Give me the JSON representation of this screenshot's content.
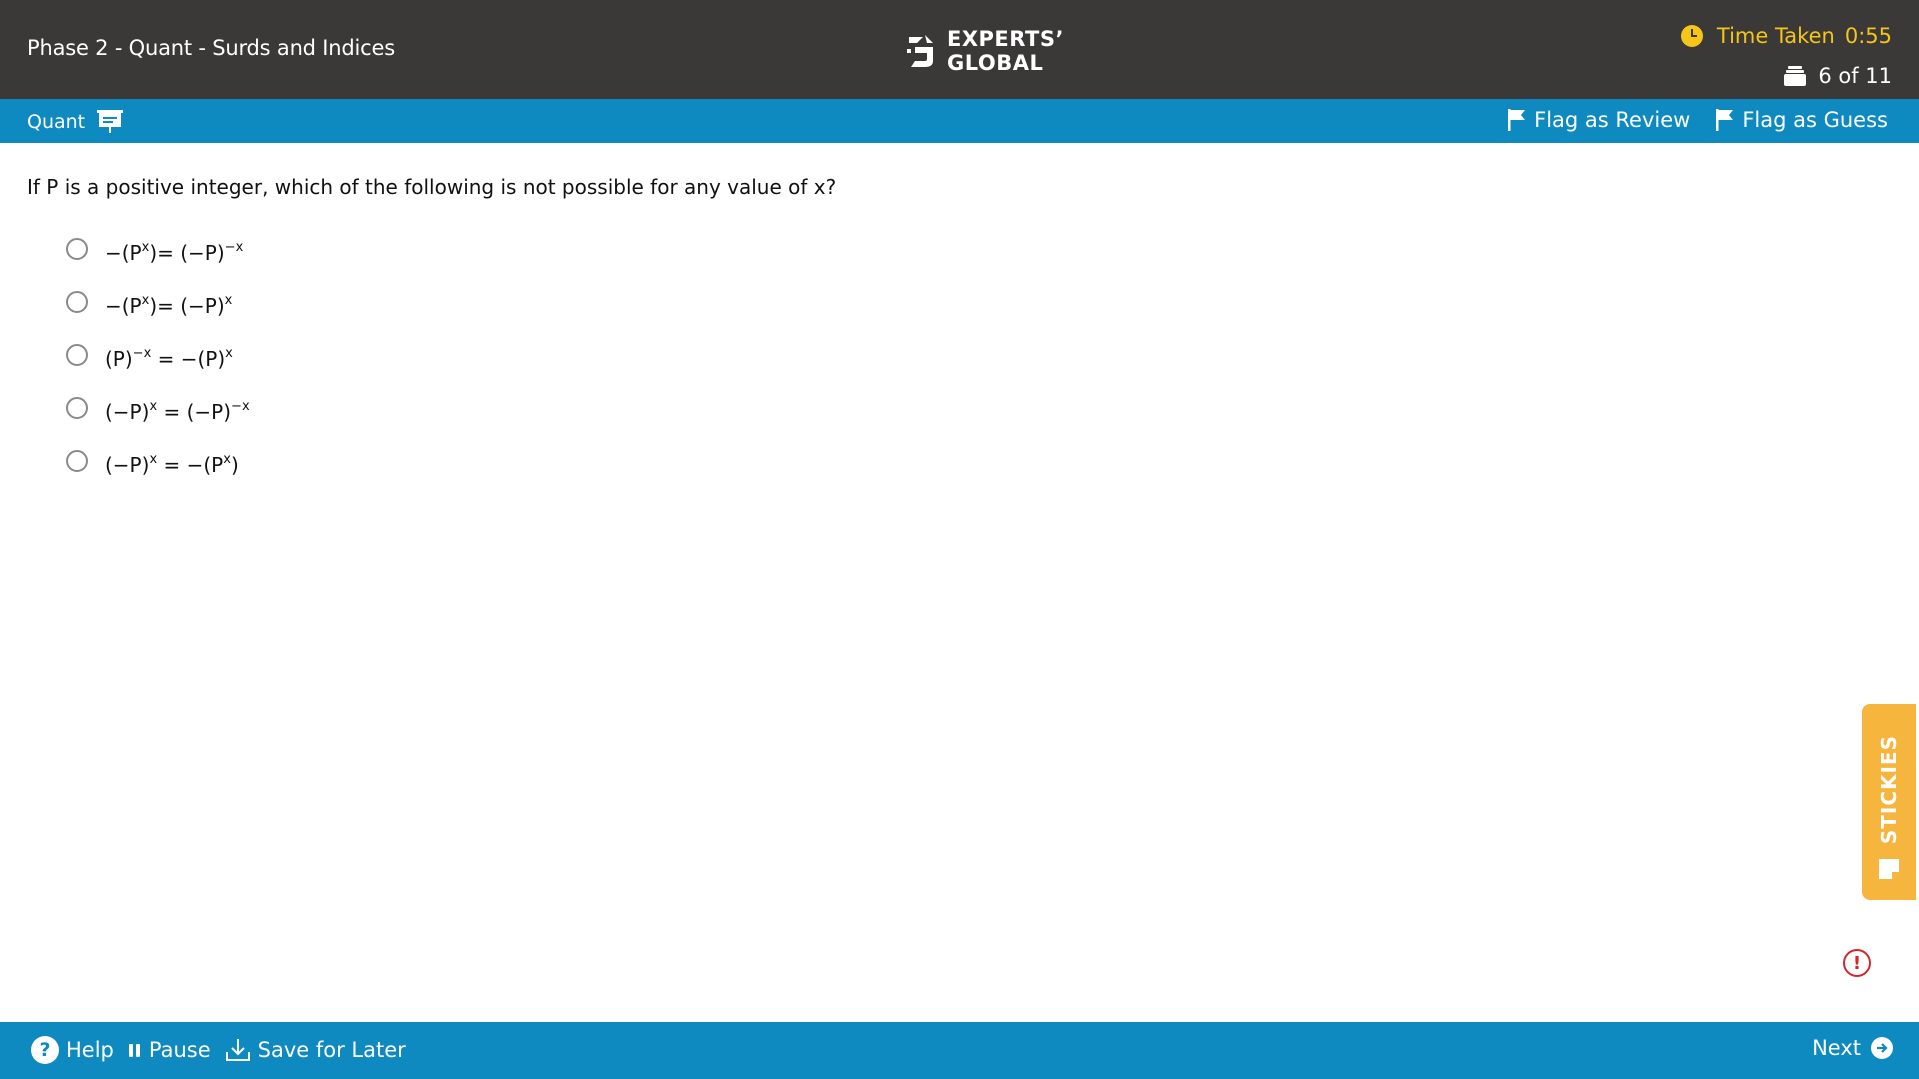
{
  "header": {
    "exam_title": "Phase 2 - Quant - Surds and Indices",
    "logo": {
      "line1": "EXPERTS’",
      "line2": "GLOBAL"
    },
    "timer_label": "Time Taken",
    "timer_value": "0:55",
    "question_counter": "6 of 11"
  },
  "section_bar": {
    "section_name": "Quant",
    "flag_review_label": "Flag as Review",
    "flag_guess_label": "Flag as Guess"
  },
  "question": {
    "text": "If P is a positive integer, which of the following is not possible for any value of x?",
    "options": [
      {
        "label": "−(P^x)= (−P)^−x"
      },
      {
        "label": "−(P^x)= (−P)^x"
      },
      {
        "label": "(P)^−x = −(P)^x"
      },
      {
        "label": "(−P)^x = (−P)^−x"
      },
      {
        "label": "(−P)^x = −(P^x)"
      }
    ],
    "selected_option": null
  },
  "stickies": {
    "label": "STICKIES"
  },
  "footer": {
    "help_label": "Help",
    "pause_label": "Pause",
    "save_label": "Save for Later",
    "next_label": "Next"
  },
  "colors": {
    "header_bg": "#3b3838",
    "accent_blue": "#0e8ac0",
    "timer_yellow": "#f5c518",
    "stickies_orange": "#f6b53c",
    "alert_red": "#d3262b"
  },
  "icons": {
    "timer": "clock-icon",
    "counter": "question-stack-icon",
    "section": "presentation-icon",
    "flag": "flag-icon",
    "help": "help-icon",
    "pause": "pause-icon",
    "save": "download-icon",
    "next": "arrow-right-icon",
    "stickies": "sticky-note-icon",
    "alert": "alert-icon"
  }
}
